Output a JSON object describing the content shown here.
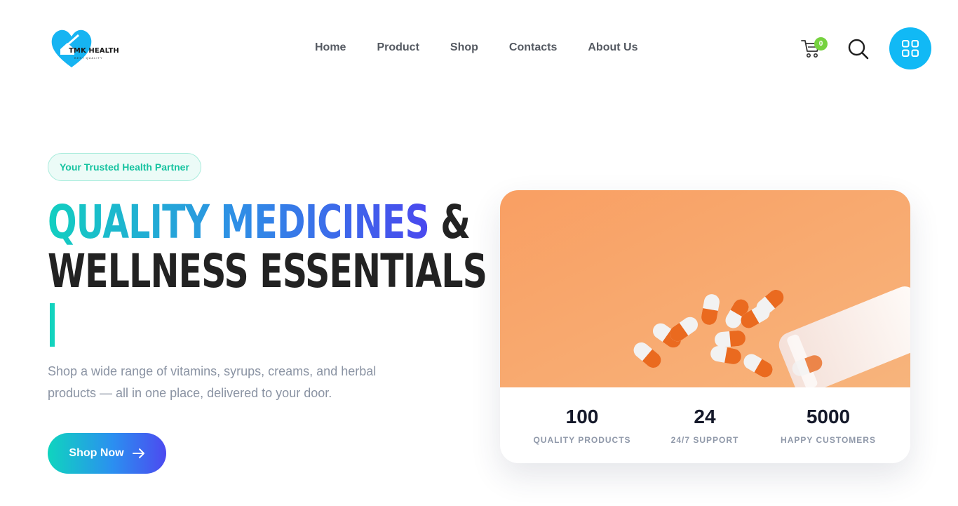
{
  "header": {
    "logo_text": "TMK HEALTH",
    "logo_sub": "BEST QUALITY",
    "nav": [
      "Home",
      "Product",
      "Shop",
      "Contacts",
      "About Us"
    ],
    "cart_count": "0",
    "icons": {
      "cart": "cart-icon",
      "search": "search-icon",
      "menu": "grid-menu-icon"
    }
  },
  "hero": {
    "badge": "Your Trusted Health Partner",
    "headline_gradient": "QUALITY MEDICINES",
    "headline_amp": " &",
    "headline_line2": "WELLNESS ESSENTIALS",
    "description": "Shop a wide range of vitamins, syrups, creams, and herbal products — all in one place, delivered to your door.",
    "cta": "Shop Now"
  },
  "stats": [
    {
      "number": "100",
      "label": "QUALITY PRODUCTS"
    },
    {
      "number": "24",
      "label": "24/7 SUPPORT"
    },
    {
      "number": "5000",
      "label": "HAPPY CUSTOMERS"
    }
  ],
  "colors": {
    "accent_blue": "#11b9f5",
    "accent_teal": "#13d3be",
    "gradient_end": "#4a48ee",
    "cart_badge": "#76d23f",
    "image_background": "#f7a870"
  }
}
